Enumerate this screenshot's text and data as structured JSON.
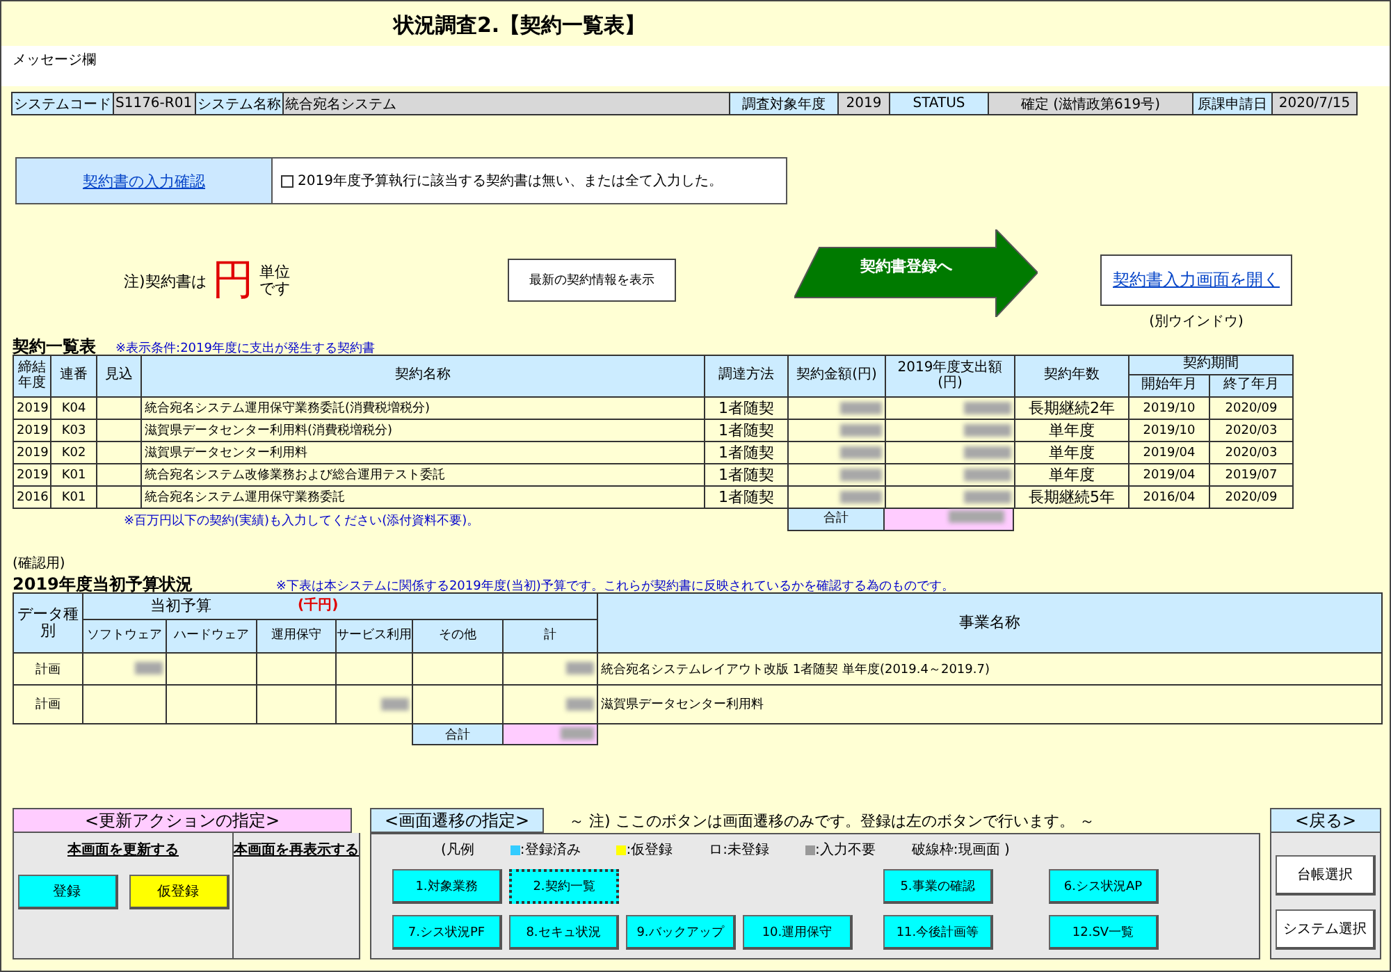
{
  "title": "状況調査2.【契約一覧表】",
  "message_label": "メッセージ欄",
  "system_bar": [
    {
      "label": "システムコード",
      "value": "S1176-R01"
    },
    {
      "label": "システム名称",
      "value": "統合宛名システム"
    },
    {
      "label": "調査対象年度",
      "value": "2019"
    },
    {
      "label": "STATUS",
      "value": "確定 (滋情政第619号)"
    },
    {
      "label": "原課申請日",
      "value": "2020/7/15"
    }
  ],
  "confirm": {
    "link": "契約書の入力確認",
    "checkbox_label": "2019年度予算執行に該当する契約書は無い、または全て入力した。",
    "checked": false
  },
  "unit_note": {
    "prefix": "注)契約書は",
    "unit": "円",
    "suffix": "単位です"
  },
  "refresh_button": "最新の契約情報を表示",
  "register_arrow": "契約書登録へ",
  "open_input_link": "契約書入力画面を開く",
  "open_input_note": "(別ウインドウ)",
  "contracts": {
    "title": "契約一覧表",
    "condition": "※表示条件:2019年度に支出が発生する契約書",
    "columns": [
      "締結年度",
      "連番",
      "見込",
      "契約名称",
      "調達方法",
      "契約金額(円)",
      "2019年度支出額(円)",
      "契約年数",
      "契約期間"
    ],
    "period_columns": [
      "開始年月",
      "終了年月"
    ],
    "rows": [
      {
        "year": "2019",
        "no": "K04",
        "name": "統合宛名システム運用保守業務委託(消費税増税分)",
        "method": "1者随契",
        "masked": true,
        "term": "長期継続2年",
        "start": "2019/10",
        "end": "2020/09"
      },
      {
        "year": "2019",
        "no": "K03",
        "name": "滋賀県データセンター利用料(消費税増税分)",
        "method": "1者随契",
        "masked": true,
        "term": "単年度",
        "start": "2019/10",
        "end": "2020/03"
      },
      {
        "year": "2019",
        "no": "K02",
        "name": "滋賀県データセンター利用料",
        "method": "1者随契",
        "masked": true,
        "term": "単年度",
        "start": "2019/04",
        "end": "2020/03"
      },
      {
        "year": "2019",
        "no": "K01",
        "name": "統合宛名システム改修業務および総合運用テスト委託",
        "method": "1者随契",
        "masked": true,
        "term": "単年度",
        "start": "2019/04",
        "end": "2019/07"
      },
      {
        "year": "2016",
        "no": "K01",
        "name": "統合宛名システム運用保守業務委託",
        "method": "1者随契",
        "masked": true,
        "term": "長期継続5年",
        "start": "2016/04",
        "end": "2020/09"
      }
    ],
    "footnote": "※百万円以下の契約(実績)も入力してください(添付資料不要)。",
    "total_label": "合計",
    "total_masked": true
  },
  "budget": {
    "check_label": "(確認用)",
    "title": "2019年度当初予算状況",
    "note": "※下表は本システムに関係する2019年度(当初)予算です。これらが契約書に反映されているかを確認する為のものです。",
    "type_header": "データ種別",
    "group_header": "当初予算",
    "unit_header": "(千円)",
    "columns": [
      "ソフトウェア",
      "ハードウェア",
      "運用保守",
      "サービス利用",
      "その他",
      "計"
    ],
    "name_header": "事業名称",
    "rows": [
      {
        "type": "計画",
        "masked": [
          true,
          false,
          false,
          false,
          false,
          true
        ],
        "name": "統合宛名システムレイアウト改版 1者随契 単年度(2019.4～2019.7)"
      },
      {
        "type": "計画",
        "masked": [
          false,
          false,
          false,
          true,
          false,
          true
        ],
        "name": "滋賀県データセンター利用料"
      }
    ],
    "total_label": "合計",
    "total_masked": true
  },
  "update_panel": {
    "title": "<更新アクションの指定>",
    "update_label": "本画面を更新する",
    "buttons": [
      {
        "label": "登録",
        "color": "#00ffff"
      },
      {
        "label": "仮登録",
        "color": "#ffff00"
      }
    ],
    "redisplay_label": "本画面を再表示する"
  },
  "transition_panel": {
    "title": "<画面遷移の指定>",
    "note": "～ 注) ここのボタンは画面遷移のみです。登録は左のボタンで行います。 ～",
    "legend": [
      {
        "kind": "text",
        "label": "(凡例"
      },
      {
        "kind": "swatch",
        "color": "#33ccff",
        "label": ":登録済み"
      },
      {
        "kind": "swatch",
        "color": "#ffff00",
        "label": ":仮登録"
      },
      {
        "kind": "text",
        "label": "ロ:未登録"
      },
      {
        "kind": "swatch",
        "color": "#999999",
        "label": ":入力不要"
      },
      {
        "kind": "text",
        "label": "破線枠:現画面 )"
      }
    ],
    "buttons": [
      {
        "kind": "button",
        "label": "1.対象業務",
        "selected": false
      },
      {
        "kind": "button",
        "label": "2.契約一覧",
        "selected": true
      },
      {
        "kind": "empty"
      },
      {
        "kind": "empty"
      },
      {
        "kind": "button",
        "label": "5.事業の確認",
        "selected": false
      },
      {
        "kind": "button",
        "label": "6.シス状況AP",
        "selected": false
      },
      {
        "kind": "button",
        "label": "7.シス状況PF",
        "selected": false
      },
      {
        "kind": "button",
        "label": "8.セキュ状況",
        "selected": false
      },
      {
        "kind": "button",
        "label": "9.バックアップ",
        "selected": false
      },
      {
        "kind": "button",
        "label": "10.運用保守",
        "selected": false
      },
      {
        "kind": "button",
        "label": "11.今後計画等",
        "selected": false
      },
      {
        "kind": "button",
        "label": "12.SV一覧",
        "selected": false
      }
    ]
  },
  "back_panel": {
    "title": "<戻る>",
    "buttons": [
      "台帳選択",
      "システム選択"
    ]
  }
}
